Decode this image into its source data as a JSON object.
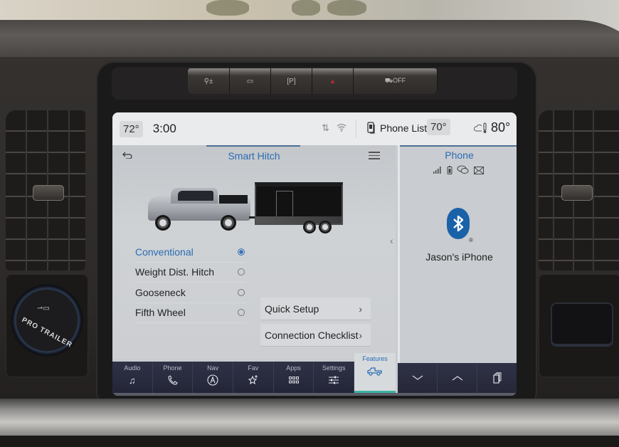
{
  "hardware_buttons": [
    {
      "icon": "heated-seat-icon",
      "glyph": "⚲±"
    },
    {
      "icon": "rear-defrost-icon",
      "glyph": "▭"
    },
    {
      "icon": "park-assist-icon",
      "glyph": "[P]"
    },
    {
      "icon": "hazard-icon",
      "glyph": "▲"
    },
    {
      "icon": "traction-control-off-icon",
      "glyph": "⛟OFF"
    }
  ],
  "knob": {
    "label": "PRO TRAILER"
  },
  "status_bar": {
    "left_temp": "72°",
    "time": "3:00",
    "phone_list_label": "Phone List",
    "right_temp": "70°",
    "outside_temp": "80°"
  },
  "main_panel": {
    "title": "Smart Hitch",
    "options": [
      {
        "label": "Conventional",
        "selected": true
      },
      {
        "label": "Weight Dist. Hitch",
        "selected": false
      },
      {
        "label": "Gooseneck",
        "selected": false
      },
      {
        "label": "Fifth Wheel",
        "selected": false
      }
    ],
    "actions": [
      {
        "label": "Quick Setup"
      },
      {
        "label": "Connection Checklist"
      }
    ]
  },
  "side_panel": {
    "title": "Phone",
    "device_name": "Jason's iPhone",
    "registered_mark": "®"
  },
  "dock": {
    "items": [
      {
        "label": "Audio",
        "icon": "music-note-icon",
        "glyph": "♫"
      },
      {
        "label": "Phone",
        "icon": "phone-icon",
        "glyph": "✆"
      },
      {
        "label": "Nav",
        "icon": "nav-icon",
        "glyph": "Ⓐ"
      },
      {
        "label": "Fav",
        "icon": "favorite-star-icon",
        "glyph": "☆⁺"
      },
      {
        "label": "Apps",
        "icon": "apps-grid-icon",
        "glyph": "▪▪▪"
      },
      {
        "label": "Settings",
        "icon": "settings-sliders-icon",
        "glyph": "☰"
      }
    ],
    "active": {
      "label": "Features",
      "icon": "truck-icon"
    }
  },
  "colors": {
    "accent_blue": "#2a6db4",
    "features_underline": "#39b3a2",
    "bluetooth_blue": "#1a62a8",
    "dock_bg": "#2a2d40"
  }
}
